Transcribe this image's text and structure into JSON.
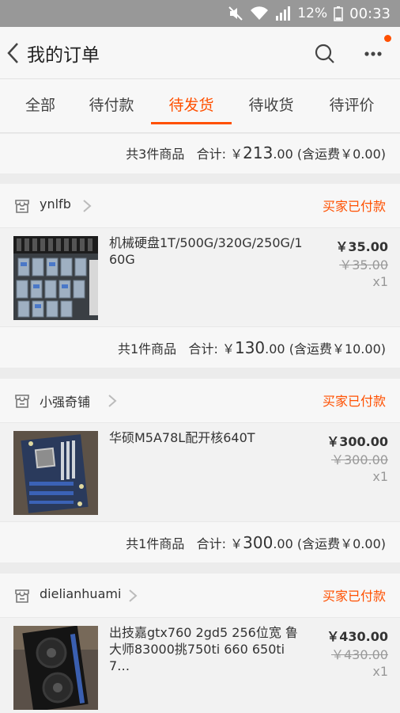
{
  "status_bar": {
    "battery": "12%",
    "time": "00:33"
  },
  "header": {
    "title": "我的订单"
  },
  "tabs": [
    {
      "label": "全部"
    },
    {
      "label": "待付款"
    },
    {
      "label": "待发货"
    },
    {
      "label": "待收货"
    },
    {
      "label": "待评价"
    }
  ],
  "summary": {
    "count": "共3件商品",
    "total_label": "合计:",
    "currency": "￥",
    "total_big": "213",
    "total_small": ".00",
    "shipping": "(含运费￥0.00)"
  },
  "orders": [
    {
      "shop": "ynlfb",
      "status": "买家已付款",
      "item_title": "机械硬盘1T/500G/320G/250G/160G",
      "price": "￥35.00",
      "orig_price": "￥35.00",
      "qty": "x1",
      "footer": {
        "count": "共1件商品",
        "total_label": "合计:",
        "currency": "￥",
        "total_big": "130",
        "total_small": ".00",
        "shipping": "(含运费￥10.00)"
      }
    },
    {
      "shop": "小强奇铺",
      "status": "买家已付款",
      "item_title": "华硕M5A78L配开核640T",
      "price": "￥300.00",
      "orig_price": "￥300.00",
      "qty": "x1",
      "footer": {
        "count": "共1件商品",
        "total_label": "合计:",
        "currency": "￥",
        "total_big": "300",
        "total_small": ".00",
        "shipping": "(含运费￥0.00)"
      }
    },
    {
      "shop": "dielianhuami",
      "status": "买家已付款",
      "item_title": "出技嘉gtx760 2gd5 256位宽 鲁大师83000挑750ti 660 650ti 7…",
      "price": "￥430.00",
      "orig_price": "￥430.00",
      "qty": "x1"
    }
  ],
  "colors": {
    "accent": "#ff5000",
    "status_bar": "#989898"
  }
}
